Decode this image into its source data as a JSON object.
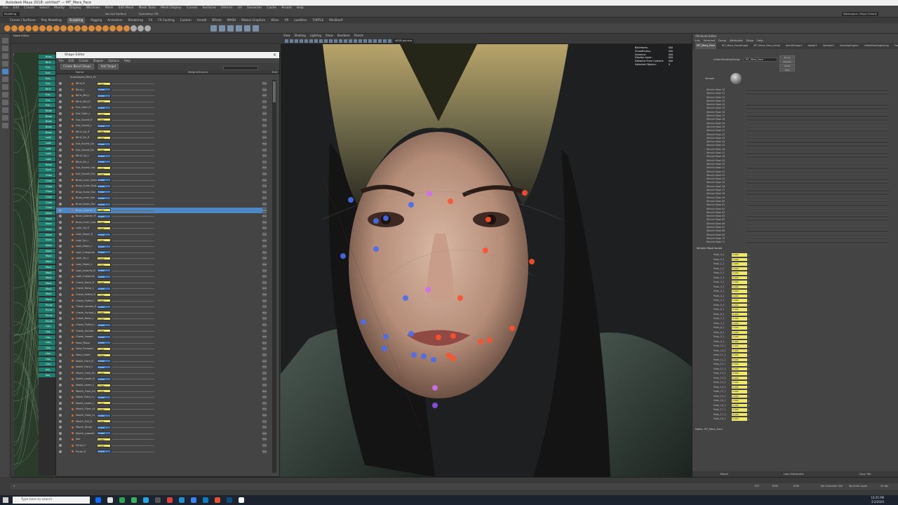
{
  "window": {
    "title": "Autodesk Maya 2018: untitled* — MT_Mera_Face"
  },
  "menubar": [
    "File",
    "Edit",
    "Create",
    "Select",
    "Modify",
    "Display",
    "Windows",
    "Mesh",
    "Edit Mesh",
    "Mesh Tools",
    "Mesh Display",
    "Curves",
    "Surfaces",
    "Deform",
    "UV",
    "Generate",
    "Cache",
    "Arnold",
    "Help"
  ],
  "status": {
    "mode": "Modeling",
    "symmetry": "Symmetry: Off",
    "live": "No Live Surface",
    "workspace": "Workspace: Maya Classic"
  },
  "shelf_tabs": [
    "Curves / Surfaces",
    "Poly Modeling",
    "Sculpting",
    "Rigging",
    "Animation",
    "Rendering",
    "FX",
    "FX Caching",
    "Custom",
    "Arnold",
    "Bifrost",
    "MASH",
    "Motion Graphics",
    "XGen",
    "VR",
    "LookDev",
    "TURTLE",
    "MiniShelf"
  ],
  "shelf_active": "Sculpting",
  "node_editor": {
    "title": "Node Editor",
    "tab": "Untitled_1"
  },
  "outliner_rows": [
    "Brow_",
    "Blnk",
    "Eye_",
    "Eye_",
    "Eye_",
    "Eye_",
    "Blnk",
    "Eye_",
    "Eye_",
    "Eye_",
    "Brow",
    "Brow",
    "Brow",
    "Brow",
    "Brow",
    "Look",
    "Look",
    "Look",
    "Look",
    "Look",
    "Brow",
    "Sqnt",
    "Chee",
    "Chee",
    "Chee",
    "Chee",
    "Chee",
    "Chee",
    "Chee",
    "Nose",
    "Nose",
    "Nose",
    "Nose",
    "Nose",
    "Nose",
    "Nose",
    "Nose",
    "Mout",
    "Mout",
    "Mout",
    "Mout",
    "Mout",
    "Mout",
    "Mout",
    "Mout",
    "Mout",
    "Purse",
    "Purse",
    "Purse",
    "Purse",
    "Lips_",
    "Lips_",
    "Lips_",
    "Lips_",
    "Lips_",
    "Lips_",
    "Lips_",
    "Lips_",
    "Jaw_",
    "Jaw_"
  ],
  "shape_editor": {
    "title": "Shape Editor",
    "menu": [
      "File",
      "Edit",
      "Create",
      "Shapes",
      "Options",
      "Help"
    ],
    "create_btn": "Create Blend Shape",
    "add_btn": "Add Target",
    "col_name": "Name",
    "col_weight": "Weight/Drivers",
    "col_edit": "Edit",
    "group": "Autoshapes_Mera_Fa",
    "rows": [
      "Blink_R",
      "Blink_L",
      "Blink_Mid_L",
      "Blink_Mid_R",
      "Eye_Open_R",
      "Eye_Open_L",
      "Eye_Squint_R",
      "Eye_Squint_L",
      "Blink_Up_R",
      "Blink_Dn_R",
      "Eye_Squint_Up",
      "Eye_Squint_Dn",
      "Blink_Up_L",
      "Blink_Dn_L",
      "Eye_Squint_UpL",
      "Eye_Squint_DnL",
      "Brow_Inner_Raise",
      "Brow_Outer_Raise",
      "Brow_Outer_Rai",
      "Brow_Inner_Rai",
      "Brow_Down_Rai",
      "Brow_Lowerer_L",
      "Brow_Lowerer_R",
      "Brow_Inner_Low",
      "Look_Up_R",
      "Look_Down_R",
      "Look_Up_L",
      "Look_Down_L",
      "Look_Outwards",
      "Look_Up_L",
      "Look_Down_L",
      "Look_Inwards_R",
      "Look_Outwards",
      "Cheek_Raise_R",
      "Cheek_Raise_L",
      "Cheek_Puffed_R",
      "Cheek_Puffed_L",
      "Cheek_Sucked_R",
      "Cheek_Sucked_L",
      "Cheek_Raise_L",
      "Cheek_Puffed_L",
      "Cheek_Sucked",
      "Cheek_Inward",
      "Nose_Raise",
      "Nose_Forward",
      "Nose_Lower",
      "Nostrl_Flare_R",
      "Nostrl_Flare_L",
      "Mouth_Flare_Ru",
      "Nostrl_Lower_R",
      "Nostrl_Lower_L",
      "Mouth_Flare_Rd",
      "Nostrl_Flare_Lu",
      "Nostrl_Lower_L",
      "Mouth_Flare_Ld",
      "Mouth_Flare_Lu",
      "Mouth_Pull_R",
      "Mouth_Dimpl",
      "Mouth_Lowerer",
      "Jaw",
      "Purse_U",
      "Purse_D"
    ],
    "weight_value": "0.000",
    "selected_row": "Brow_Lowerer_L"
  },
  "viewport": {
    "menu": [
      "View",
      "Shading",
      "Lighting",
      "Show",
      "Renderer",
      "Panels"
    ],
    "camera": "sRGB gamma",
    "hud": [
      {
        "k": "Backfaces:",
        "v": "N/A"
      },
      {
        "k": "Smoothness:",
        "v": "N/A"
      },
      {
        "k": "Instance:",
        "v": "N/A"
      },
      {
        "k": "Display Layer:",
        "v": "N/A"
      },
      {
        "k": "Distance From Camera:",
        "v": "N/A"
      },
      {
        "k": "Selected Objects:",
        "v": "0"
      }
    ]
  },
  "attribute_editor": {
    "title": "Attribute Editor",
    "menu": [
      "List",
      "Selected",
      "Focus",
      "Attributes",
      "Show",
      "Help"
    ],
    "tabs": [
      "MT_Mera_Face",
      "MT_Mera_FaceShape",
      "MT_Mera_Face_Initial",
      "blendShape1",
      "tweak1",
      "lambert1",
      "shadingEngine",
      "initialShadingGroup",
      "Face"
    ],
    "node_label": "initialShadingGroup",
    "node_field": "MT_Mera_Face",
    "btns": [
      "Focus",
      "Presets",
      "Show",
      "Hide"
    ],
    "sample_label": "Sample",
    "wrinkle_masks": [
      "Wrinkle Mask 30",
      "Wrinkle Mask 31",
      "Wrinkle Mask 32",
      "Wrinkle Mask 33",
      "Wrinkle Mask 34",
      "Wrinkle Mask 35",
      "Wrinkle Mask 36",
      "Wrinkle Mask 37",
      "Wrinkle Mask 38",
      "Wrinkle Mask 39",
      "Wrinkle Mask 40",
      "Wrinkle Mask 41",
      "Wrinkle Mask 42",
      "Wrinkle Mask 43",
      "Wrinkle Mask 44",
      "Wrinkle Mask 45",
      "Wrinkle Mask 46",
      "Wrinkle Mask 47",
      "Wrinkle Mask 48",
      "Wrinkle Mask 49",
      "Wrinkle Mask 50",
      "Wrinkle Mask 51",
      "Wrinkle Mask 52",
      "Wrinkle Mask 53",
      "Wrinkle Mask 54",
      "Wrinkle Mask 55",
      "Wrinkle Mask 56",
      "Wrinkle Mask 57",
      "Wrinkle Mask 58",
      "Wrinkle Mask 59",
      "Wrinkle Mask 60",
      "Wrinkle Mask 61",
      "Wrinkle Mask 62",
      "Wrinkle Mask 63",
      "Wrinkle Mask 64",
      "Wrinkle Mask 65",
      "Wrinkle Mask 66",
      "Wrinkle Mask 67",
      "Wrinkle Mask 68",
      "Wrinkle Mask 69",
      "Wrinkle Mask 70",
      "Wrinkle Mask 71"
    ],
    "wi_head": "Wrinkle Mask Inputs",
    "wi_items": [
      "Mask_0_1",
      "Mask_0_2",
      "Mask_1_1",
      "Mask_1_2",
      "Mask_2_1",
      "Mask_2_2",
      "Mask_3_1",
      "Mask_3_2",
      "Mask_4_1",
      "Mask_4_2",
      "Mask_5_1",
      "Mask_5_2",
      "Mask_6_1",
      "Mask_6_2",
      "Mask_7_1",
      "Mask_7_2",
      "Mask_8_1",
      "Mask_8_2",
      "Mask_9_1",
      "Mask_9_2",
      "Mask_10_1",
      "Mask_10_2",
      "Mask_11_1",
      "Mask_11_2",
      "Mask_12_1",
      "Mask_12_2",
      "Mask_13_1",
      "Mask_13_2",
      "Mask_14_1",
      "Mask_14_2",
      "Mask_15_1",
      "Mask_15_2",
      "Mask_16_1",
      "Mask_16_2",
      "Mask_17_1",
      "Mask_17_2",
      "Mask_18_1"
    ],
    "wi_value": "0.000",
    "notes": "Notes: MT_Mera_Face",
    "bottom": [
      "Select",
      "Load Attributes",
      "Copy Tab"
    ]
  },
  "range": {
    "start": "1",
    "end": "120",
    "end2": "1000",
    "end3": "1000",
    "charset": "No Character Set",
    "layer": "No Anim Layer",
    "fps": "24 fps"
  },
  "taskbar": {
    "search": "Type here to search",
    "time": "10:25 PM",
    "date": "2/3/2020"
  },
  "colors": {
    "accent": "#4d88c4",
    "slider_yellow": "#f0e86a",
    "outliner_teal": "#1e7c6e"
  }
}
